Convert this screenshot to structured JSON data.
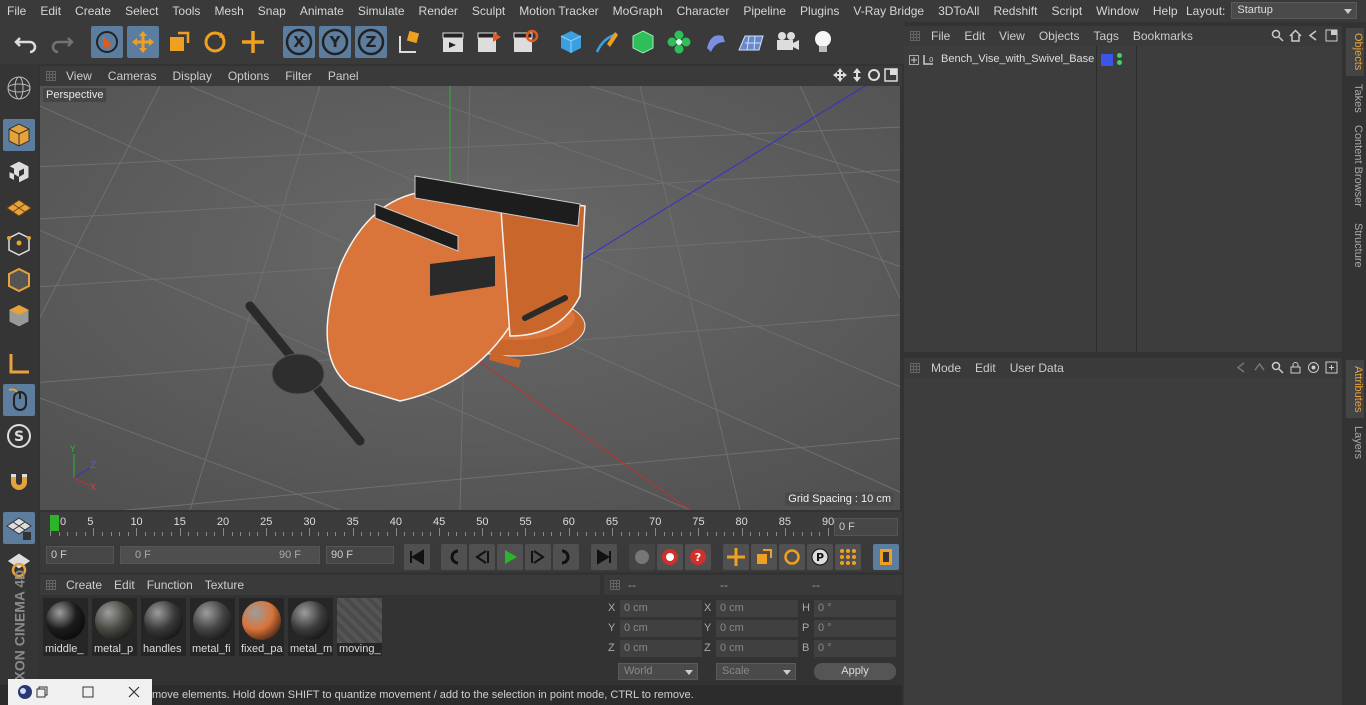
{
  "menubar": {
    "items": [
      "File",
      "Edit",
      "Create",
      "Select",
      "Tools",
      "Mesh",
      "Snap",
      "Animate",
      "Simulate",
      "Render",
      "Sculpt",
      "Motion Tracker",
      "MoGraph",
      "Character",
      "Pipeline",
      "Plugins",
      "V-Ray Bridge",
      "3DToAll",
      "Redshift",
      "Script",
      "Window",
      "Help"
    ],
    "layout_label": "Layout:",
    "layout_value": "Startup"
  },
  "viewport": {
    "menu": [
      "View",
      "Cameras",
      "Display",
      "Options",
      "Filter",
      "Panel"
    ],
    "label": "Perspective",
    "grid_spacing": "Grid Spacing : 10 cm"
  },
  "timeline": {
    "ticks": [
      "0",
      "5",
      "10",
      "15",
      "20",
      "25",
      "30",
      "35",
      "40",
      "45",
      "50",
      "55",
      "60",
      "65",
      "70",
      "75",
      "80",
      "85",
      "90"
    ],
    "current_frame": "0 F"
  },
  "transport": {
    "start": "0 F",
    "range_start": "0 F",
    "range_end": "90 F",
    "end": "90 F"
  },
  "materials": {
    "menu": [
      "Create",
      "Edit",
      "Function",
      "Texture"
    ],
    "items": [
      {
        "name": "middle_",
        "color": "#1c1c1c"
      },
      {
        "name": "metal_p",
        "color": "#4a4a44"
      },
      {
        "name": "handles",
        "color": "#3a3a3a"
      },
      {
        "name": "metal_fi",
        "color": "#444444"
      },
      {
        "name": "fixed_pa",
        "color": "#d9743a"
      },
      {
        "name": "metal_m",
        "color": "#3c3c3c"
      },
      {
        "name": "moving_",
        "color": ""
      }
    ]
  },
  "coords": {
    "headers": [
      "--",
      "--",
      "--"
    ],
    "rows": [
      {
        "a": "X",
        "av": "0 cm",
        "b": "X",
        "bv": "0 cm",
        "c": "H",
        "cv": "0 °"
      },
      {
        "a": "Y",
        "av": "0 cm",
        "b": "Y",
        "bv": "0 cm",
        "c": "P",
        "cv": "0 °"
      },
      {
        "a": "Z",
        "av": "0 cm",
        "b": "Z",
        "bv": "0 cm",
        "c": "B",
        "cv": "0 °"
      }
    ],
    "mode": "World",
    "scale": "Scale",
    "apply": "Apply"
  },
  "status": "move elements. Hold down SHIFT to quantize movement / add to the selection in point mode, CTRL to remove.",
  "objects": {
    "menu": [
      "File",
      "Edit",
      "View",
      "Objects",
      "Tags",
      "Bookmarks"
    ],
    "item": "Bench_Vise_with_Swivel_Base"
  },
  "attributes": {
    "menu": [
      "Mode",
      "Edit",
      "User Data"
    ]
  },
  "right_tabs": [
    "Objects",
    "Takes",
    "Content Browser",
    "Structure",
    "Attributes",
    "Layers"
  ],
  "brand": "MAXON CINEMA 4D",
  "colors": {
    "accent": "#5c7d9e",
    "orange": "#e6a33c",
    "vise": "#d9743a"
  }
}
